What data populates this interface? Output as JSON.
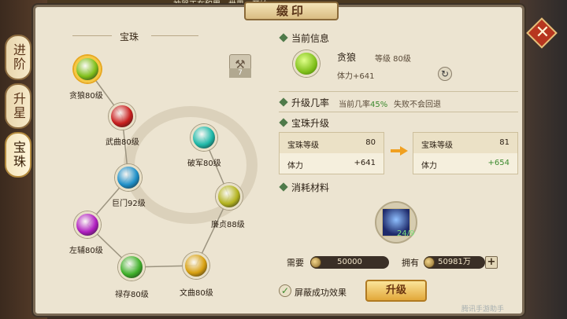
{
  "top_notice": "…神器正在积累…世界…开始…",
  "title": "缀印",
  "side_tabs": [
    {
      "label": "进阶",
      "active": false
    },
    {
      "label": "升星",
      "active": false
    },
    {
      "label": "宝珠",
      "active": true
    }
  ],
  "left_panel": {
    "header": "宝珠",
    "hammer_count": "7",
    "orbs": [
      {
        "label": "贪狼80级",
        "color": "#7fbf1a",
        "selected": true
      },
      {
        "label": "武曲80级",
        "color": "#c81e1e",
        "selected": false
      },
      {
        "label": "巨门92级",
        "color": "#1e8fc8",
        "selected": false
      },
      {
        "label": "左辅80级",
        "color": "#b01ec0",
        "selected": false
      },
      {
        "label": "禄存80级",
        "color": "#3fb02a",
        "selected": false
      },
      {
        "label": "文曲80级",
        "color": "#d8a010",
        "selected": false
      },
      {
        "label": "廉贞88级",
        "color": "#b4b420",
        "selected": false
      },
      {
        "label": "破军80级",
        "color": "#1eb8a8",
        "selected": false
      }
    ]
  },
  "current_info": {
    "section_title": "当前信息",
    "name": "贪狼",
    "level": "等级 80级",
    "stat": "体力+641"
  },
  "upgrade_rate": {
    "section_title": "升级几率",
    "label": "当前几率",
    "value": "45%",
    "note": "失败不会回退"
  },
  "orb_upgrade": {
    "section_title": "宝珠升级",
    "before": {
      "level_label": "宝珠等级",
      "level_value": "80",
      "stat_label": "体力",
      "stat_value": "+641"
    },
    "after": {
      "level_label": "宝珠等级",
      "level_value": "81",
      "stat_label": "体力",
      "stat_value": "+654"
    }
  },
  "materials": {
    "section_title": "消耗材料",
    "item_count": "24/9",
    "need_label": "需要",
    "need_value": "50000",
    "have_label": "拥有",
    "have_value": "50981万"
  },
  "shield_checkbox_label": "屏蔽成功效果",
  "upgrade_button": "升级",
  "watermark": "腾讯手游助手"
}
